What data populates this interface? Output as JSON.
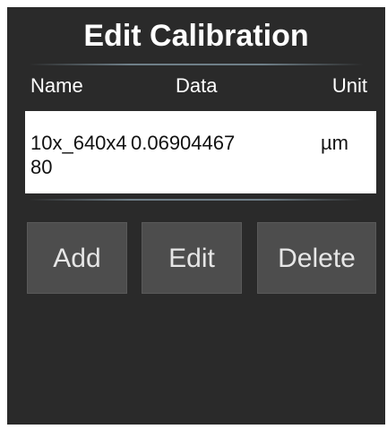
{
  "dialog": {
    "title": "Edit Calibration"
  },
  "columns": {
    "name": "Name",
    "data": "Data",
    "unit": "Unit"
  },
  "rows": [
    {
      "name": "10x_640x480",
      "data": "0.06904467",
      "unit": "µm"
    }
  ],
  "buttons": {
    "add": "Add",
    "edit": "Edit",
    "delete": "Delete"
  },
  "colors": {
    "background": "#2a2a2a",
    "list_background": "#ffffff",
    "button_background": "#4d4d4d"
  }
}
